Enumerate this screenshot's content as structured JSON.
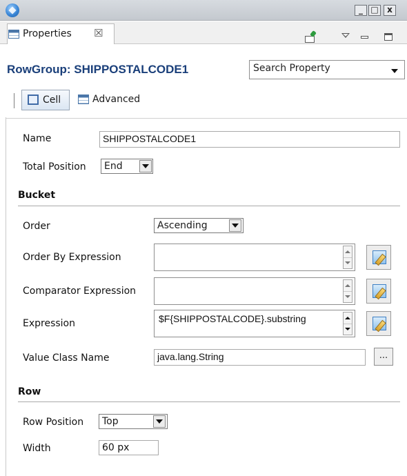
{
  "window": {
    "minimize_label": "_",
    "maximize_label": "□",
    "close_label": "x"
  },
  "view_tab": {
    "label": "Properties",
    "close_glyph": "☒"
  },
  "header": {
    "title": "RowGroup: SHIPPOSTALCODE1",
    "search_value": "Search Property"
  },
  "section_tabs": {
    "cell": "Cell",
    "advanced": "Advanced"
  },
  "general": {
    "name_label": "Name",
    "name_value": "SHIPPOSTALCODE1",
    "total_position_label": "Total Position",
    "total_position_value": "End"
  },
  "bucket": {
    "title": "Bucket",
    "order_label": "Order",
    "order_value": "Ascending",
    "order_by_expression_label": "Order By Expression",
    "order_by_expression_value": "",
    "comparator_expression_label": "Comparator Expression",
    "comparator_expression_value": "",
    "expression_label": "Expression",
    "expression_value": "$F{SHIPPOSTALCODE}.substring",
    "value_class_name_label": "Value Class Name",
    "value_class_name_value": "java.lang.String",
    "browse_label": "..."
  },
  "row": {
    "title": "Row",
    "row_position_label": "Row Position",
    "row_position_value": "Top",
    "width_label": "Width",
    "width_value": "60 px"
  }
}
